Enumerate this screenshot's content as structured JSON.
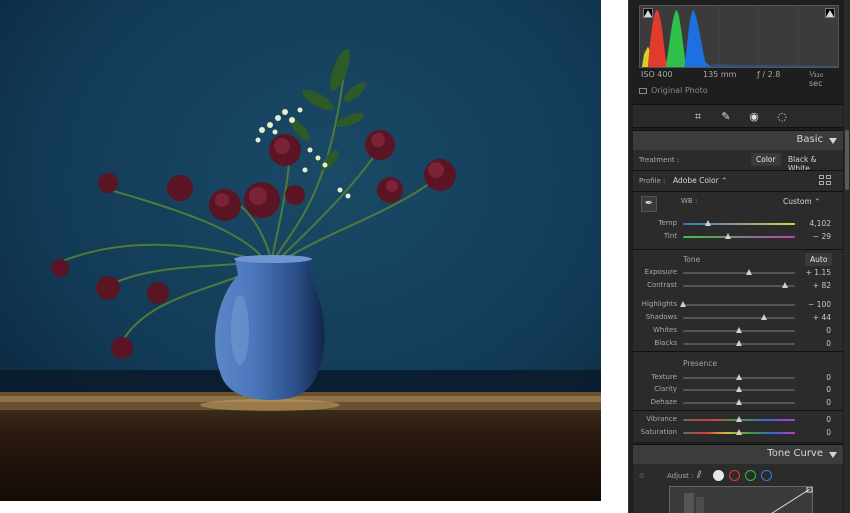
{
  "histogram": {
    "exif": {
      "iso": "ISO 400",
      "focal": "135 mm",
      "aperture": "ƒ / 2.8",
      "shutter": "¹⁄₃₂₀ sec"
    },
    "original_photo_label": "Original Photo",
    "colors": {
      "red": "#e23a2c",
      "green": "#2fbf4a",
      "blue": "#1e6fe0",
      "yellow": "#d8d02a"
    }
  },
  "toolstrip": {
    "icons": [
      "crop-icon",
      "healing-icon",
      "redeye-icon",
      "masking-icon"
    ]
  },
  "basic": {
    "title": "Basic",
    "treatment_label": "Treatment :",
    "treatment_options": [
      "Color",
      "Black & White"
    ],
    "treatment_selected": "Color",
    "profile_label": "Profile :",
    "profile_value": "Adobe Color ⌃",
    "wb_label": "WB :",
    "wb_value": "Custom ⌃",
    "temp": {
      "label": "Temp",
      "value": "4,102",
      "position": 0.22
    },
    "tint": {
      "label": "Tint",
      "value": "− 29",
      "position": 0.4
    },
    "tone_label": "Tone",
    "auto_label": "Auto",
    "exposure": {
      "label": "Exposure",
      "value": "+ 1.15",
      "position": 0.59
    },
    "contrast": {
      "label": "Contrast",
      "value": "+ 82",
      "position": 0.91
    },
    "highlights": {
      "label": "Highlights",
      "value": "− 100",
      "position": 0.0
    },
    "shadows": {
      "label": "Shadows",
      "value": "+ 44",
      "position": 0.72
    },
    "whites": {
      "label": "Whites",
      "value": "0",
      "position": 0.5
    },
    "blacks": {
      "label": "Blacks",
      "value": "0",
      "position": 0.5
    },
    "presence_label": "Presence",
    "texture": {
      "label": "Texture",
      "value": "0",
      "position": 0.5
    },
    "clarity": {
      "label": "Clarity",
      "value": "0",
      "position": 0.5
    },
    "dehaze": {
      "label": "Dehaze",
      "value": "0",
      "position": 0.5
    },
    "vibrance": {
      "label": "Vibrance",
      "value": "0",
      "position": 0.5
    },
    "saturation": {
      "label": "Saturation",
      "value": "0",
      "position": 0.5
    }
  },
  "tone_curve": {
    "title": "Tone Curve",
    "adjust_label": "Adjust :",
    "channel_colors": {
      "white": "#e6e6e6",
      "red": "#e23a2c",
      "green": "#2fbf4a",
      "blue": "#2f7fe0"
    }
  }
}
